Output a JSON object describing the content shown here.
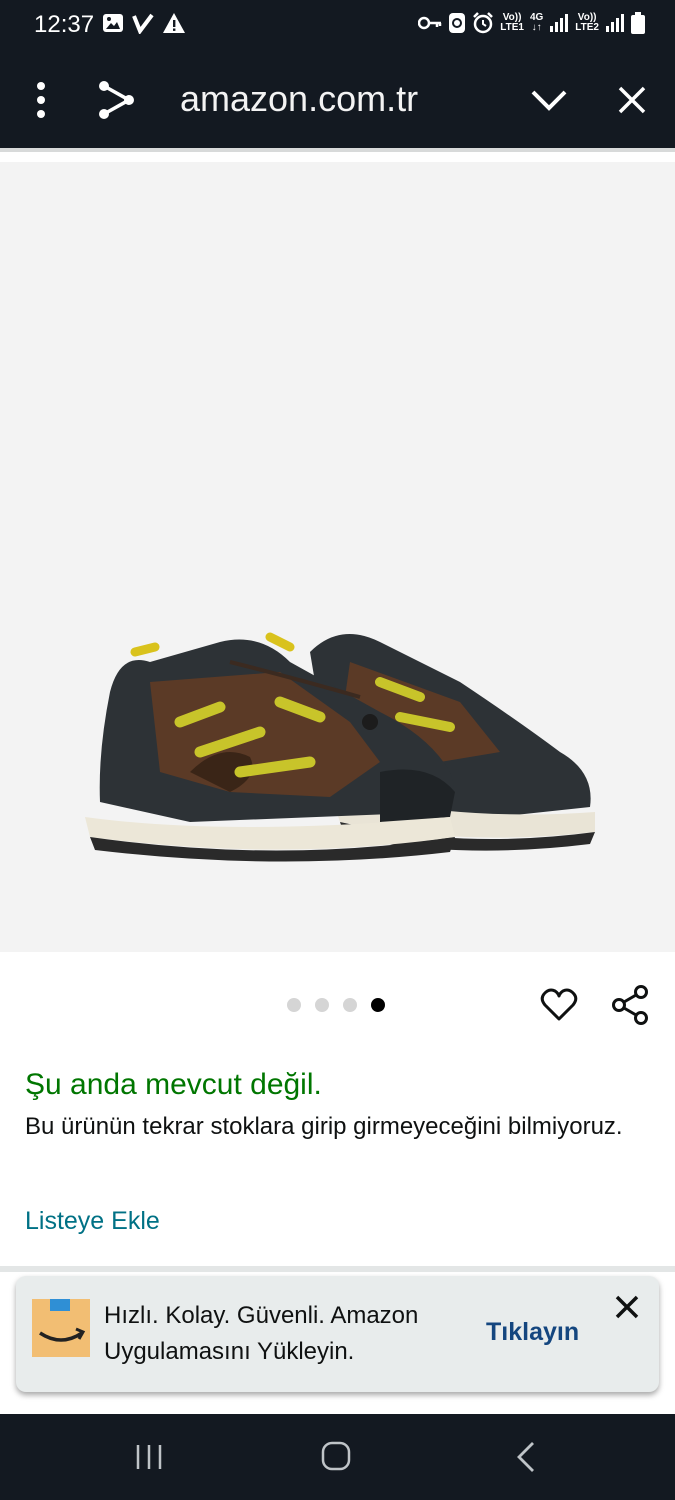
{
  "status_bar": {
    "time": "12:37",
    "left_icons": [
      "image-icon",
      "check-v-icon",
      "warning-icon"
    ],
    "right_icons": [
      "key-icon",
      "sync-icon",
      "alarm-icon",
      "volte-lte1-icon",
      "4g-data-icon",
      "signal-icon",
      "volte-lte2-icon",
      "signal-icon",
      "battery-icon"
    ],
    "net1_top": "Vo))",
    "net1_bottom": "LTE1",
    "net2_top": "4G",
    "net2_bottom": "↓↑",
    "net3_top": "Vo))",
    "net3_bottom": "LTE2"
  },
  "browser": {
    "url": "amazon.com.tr",
    "menu_icon": "more-vert-icon",
    "share_icon": "share-icon",
    "minimize_icon": "chevron-down-icon",
    "close_icon": "close-icon"
  },
  "product": {
    "image_alt_icon": "shoe-image",
    "carousel": {
      "count": 4,
      "active_index": 3
    },
    "wishlist_icon": "heart-icon",
    "share_icon": "share-icon"
  },
  "availability": {
    "status": "Şu anda mevcut değil.",
    "description": "Bu ürünün tekrar stoklara girip girmeyeceğini bilmiyoruz.",
    "add_to_list": "Listeye Ekle"
  },
  "app_banner": {
    "text": "Hızlı. Kolay. Güvenli. Amazon Uygulamasını Yükleyin.",
    "cta": "Tıklayın",
    "close_icon": "close-icon"
  },
  "colors": {
    "header_bg": "#131921",
    "available_green": "#007600",
    "link_teal": "#007185",
    "cta_blue": "#14467f"
  }
}
